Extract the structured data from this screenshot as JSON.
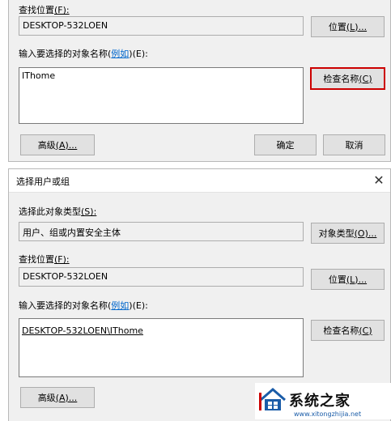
{
  "top_dialog": {
    "location_label": "查找位置",
    "location_key": "(F):",
    "location_value": "DESKTOP-532LOEN",
    "location_button": {
      "text": "位置",
      "key": "(L)..."
    },
    "names_label": "输入要选择的对象名称(",
    "names_example": "例如",
    "names_key": ")(E):",
    "names_value": "IThome",
    "check_names_button": {
      "text": "检查名称",
      "key": "(C)"
    },
    "advanced_button": {
      "text": "高级",
      "key": "(A)..."
    },
    "ok_button": "确定",
    "cancel_button": "取消"
  },
  "bottom_dialog": {
    "title": "选择用户或组",
    "close_glyph": "✕",
    "type_label": "选择此对象类型",
    "type_key": "(S):",
    "type_value": "用户、组或内置安全主体",
    "type_button": {
      "text": "对象类型",
      "key": "(O)..."
    },
    "location_label": "查找位置",
    "location_key": "(F):",
    "location_value": "DESKTOP-532LOEN",
    "location_button": {
      "text": "位置",
      "key": "(L)..."
    },
    "names_label": "输入要选择的对象名称(",
    "names_example": "例如",
    "names_key": ")(E):",
    "names_value": "DESKTOP-532LOEN\\IThome",
    "check_names_button": {
      "text": "检查名称",
      "key": "(C)"
    },
    "advanced_button": {
      "text": "高级",
      "key": "(A)..."
    }
  },
  "watermark": {
    "text": "系统之家",
    "url": "www.xitongzhijia.net",
    "logo_icon": "house-logo-icon"
  },
  "colors": {
    "dialog_bg": "#f0f0f0",
    "button_bg": "#e1e1e1",
    "highlight_border": "#cc0000",
    "link": "#0066cc"
  }
}
